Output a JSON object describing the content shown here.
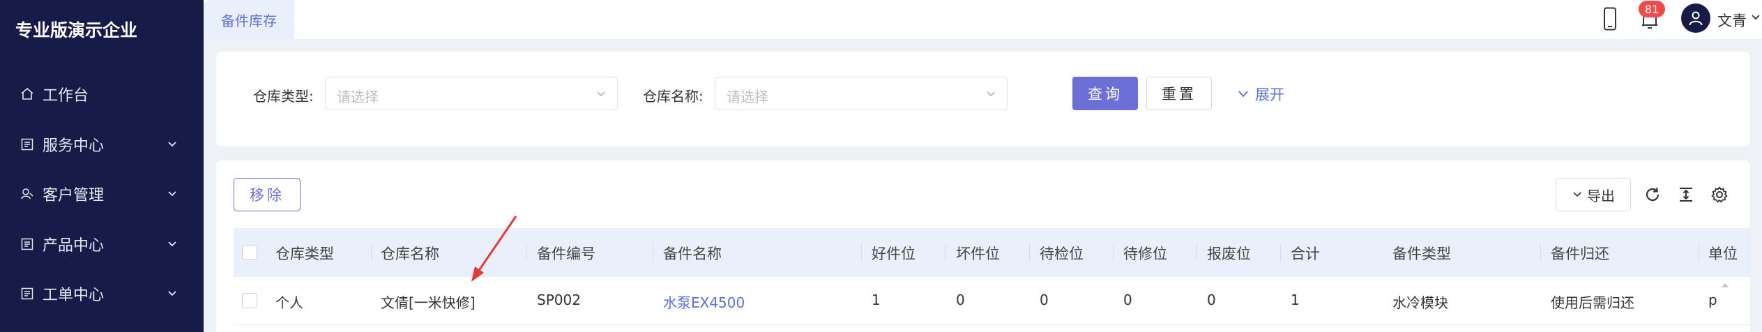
{
  "app": {
    "brand": "专业版演示企业"
  },
  "sidebar": {
    "items": [
      {
        "label": "工作台",
        "icon": "home-icon",
        "has_children": false
      },
      {
        "label": "服务中心",
        "icon": "list-icon",
        "has_children": true
      },
      {
        "label": "客户管理",
        "icon": "user-icon",
        "has_children": true
      },
      {
        "label": "产品中心",
        "icon": "list-icon",
        "has_children": true
      },
      {
        "label": "工单中心",
        "icon": "list-icon",
        "has_children": true
      }
    ]
  },
  "header": {
    "active_tab": "备件库存",
    "notification_count": "81",
    "username": "文青"
  },
  "filters": {
    "warehouse_type": {
      "label": "仓库类型:",
      "placeholder": "请选择"
    },
    "warehouse_name": {
      "label": "仓库名称:",
      "placeholder": "请选择"
    },
    "query_label": "查询",
    "reset_label": "重置",
    "expand_label": "展开"
  },
  "toolbar": {
    "remove_label": "移除",
    "export_label": "导出"
  },
  "table": {
    "columns": [
      "仓库类型",
      "仓库名称",
      "备件编号",
      "备件名称",
      "好件位",
      "坏件位",
      "待检位",
      "待修位",
      "报废位",
      "合计",
      "备件类型",
      "备件归还",
      "单位"
    ],
    "rows": [
      {
        "warehouse_type": "个人",
        "warehouse_name": "文倩[一米快修]",
        "part_no": "SP002",
        "part_name": "水泵EX4500",
        "good": "1",
        "bad": "0",
        "pending_check": "0",
        "pending_repair": "0",
        "scrap": "0",
        "total": "1",
        "part_type": "水冷模块",
        "return": "使用后需归还",
        "unit": "p"
      }
    ]
  },
  "colors": {
    "sidebar_bg": "#171b47",
    "accent": "#6c6fd6",
    "link": "#5b6fd8",
    "badge": "#f04a4a",
    "annotation_arrow": "#e53935"
  }
}
